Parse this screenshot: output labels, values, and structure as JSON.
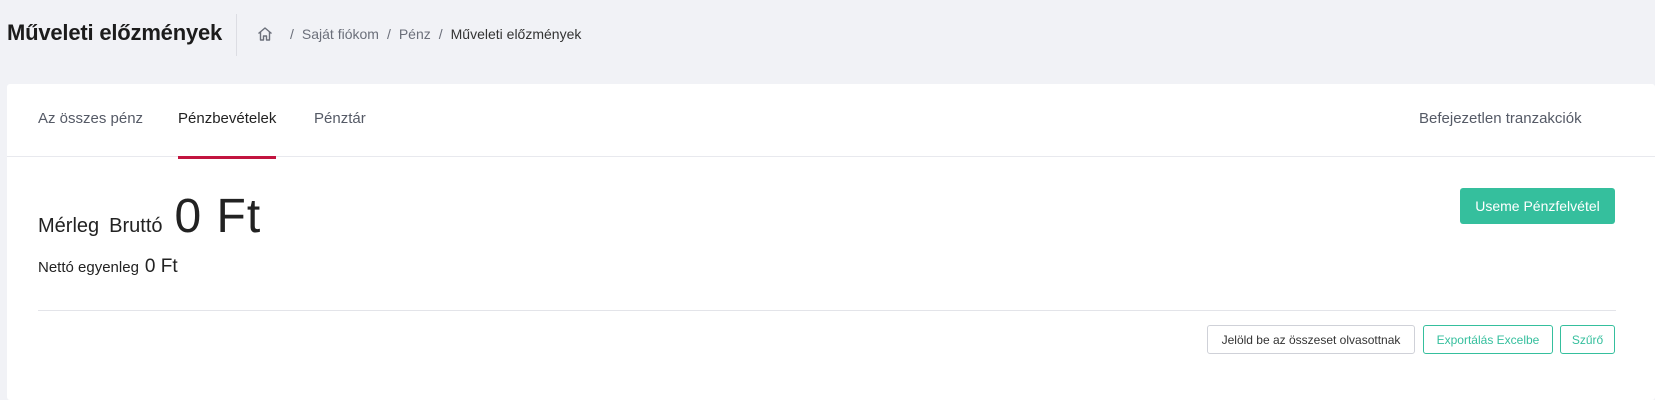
{
  "header": {
    "title": "Műveleti előzmények",
    "breadcrumb": {
      "home_icon": "home-icon",
      "items": [
        "Saját fiókom",
        "Pénz",
        "Műveleti előzmények"
      ],
      "separator": "/"
    }
  },
  "tabs": [
    {
      "label": "Az összes pénz",
      "active": false
    },
    {
      "label": "Pénzbevételek",
      "active": true
    },
    {
      "label": "Pénztár",
      "active": false
    },
    {
      "label": "Befejezetlen tranzakciók",
      "active": false
    }
  ],
  "balance": {
    "label_a": "Mérleg",
    "label_b": "Bruttó",
    "amount": "0 Ft",
    "net_label": "Nettó egyenleg",
    "net_amount": "0 Ft"
  },
  "actions": {
    "withdraw": "Useme Pénzfelvétel",
    "mark_all_read": "Jelöld be az összeset olvasottnak",
    "export_excel": "Exportálás Excelbe",
    "filter": "Szűrő"
  },
  "colors": {
    "accent_tab": "#c2143f",
    "primary_green": "#35bf9d",
    "background": "#f1f2f6"
  }
}
